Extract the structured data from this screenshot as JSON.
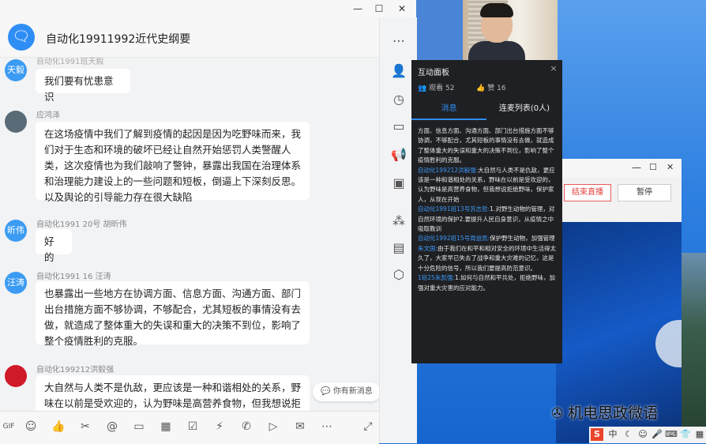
{
  "chat": {
    "group_avatar_glyph": "🗨",
    "group_title": "自动化19911992近代史纲要",
    "window_controls": {
      "minimize": "—",
      "maximize": "☐",
      "close": "✕"
    },
    "messages": [
      {
        "avatar": "天毅",
        "sender": "自动化1991班天毅",
        "text": "我们要有忧患意识"
      },
      {
        "avatar": "",
        "sender": "应鸿泽",
        "text": "在这场疫情中我们了解到疫情的起因是因为吃野味而来，我们对于生态和环境的破坏已经让自然开始惩罚人类警醒人类，这次疫情也为我们敲响了警钟，暴露出我国在治理体系和治理能力建设上的一些问题和短板，倒逼上下深刻反思。以及舆论的引导能力存在很大缺陷"
      },
      {
        "avatar": "昕伟",
        "sender": "自动化1991 20号 胡昕伟",
        "text": "好的"
      },
      {
        "avatar": "汪涛",
        "sender": "自动化1991 16 汪涛",
        "text": "也暴露出一些地方在协调方面、信息方面、沟通方面、部门出台措施方面不够协调，不够配合，尤其短板的事情没有去做，就造成了整体重大的失误和重大的决策不到位，影响了整个疫情胜利的克服。"
      },
      {
        "avatar": "",
        "sender": "自动化199212洪毅强",
        "text": "大自然与人类不是仇敌，更应该是一种和谐相处的关系，野味在以前是受欢迎的，认为野味是高营养食物，但我想说拒"
      }
    ],
    "new_message_pill": "你有新消息"
  },
  "panel": {
    "title": "互动面板",
    "close": "×",
    "viewers_label": "观看",
    "viewers": "52",
    "likes_label": "赞",
    "likes": "16",
    "tab_messages": "消息",
    "tab_mic_list": "连麦列表(0人)",
    "intro_text": "方面、信息方面、沟通方面、部门出台措施方面不够协调，不够配合，尤其短板的事情没有去做，就造成了整体重大的失误和重大的决策不到位，影响了整个疫情胜利的克服。",
    "items": [
      {
        "name": "自动化199212洪毅强:",
        "text": "大自然与人类不是仇敌，更应该是一种和谐相处的关系，野味在以前是受欢迎的，认为野味是高营养食物，但我想说拒绝野味，保护家人，从现在开始"
      },
      {
        "name": "自动化1991班13号苏志哲:",
        "text": "1.对野生动物的管理，对自然环境的保护2.要提升人民自身意识，从疫情之中吸取教训"
      },
      {
        "name": "自动化1992班15号周益凯:",
        "text": "保护野生动物，加强管理"
      },
      {
        "name": "朱文国:",
        "text": "由于我们在和平和相对安全的环境中生活得太久了，大家早已失去了战争和重大灾难的记忆，这是十分危险的信号，所以我们要提高防范意识。"
      },
      {
        "name": "1班25朱凯强:",
        "text": "1.如何与自然和平共处，拒绝野味，加强对重大灾害的应对能力。"
      }
    ]
  },
  "second_window": {
    "end_live": "结束直播",
    "pause": "暂停"
  },
  "watermark": "机电思政微语",
  "tray": {
    "ime": "中"
  }
}
